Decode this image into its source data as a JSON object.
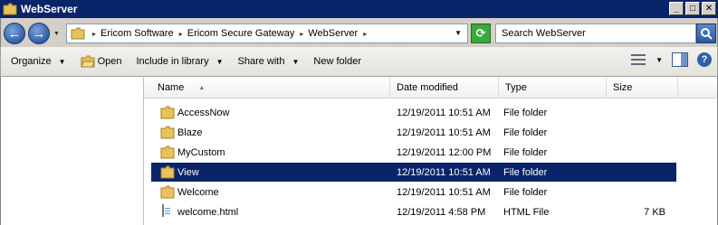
{
  "window": {
    "title": "WebServer"
  },
  "address": {
    "crumbs": [
      "Ericom Software",
      "Ericom Secure Gateway",
      "WebServer"
    ]
  },
  "search": {
    "placeholder": "Search WebServer"
  },
  "toolbar": {
    "organize_label": "Organize",
    "open_label": "Open",
    "include_label": "Include in library",
    "share_label": "Share with",
    "newfolder_label": "New folder"
  },
  "columns": {
    "name": "Name",
    "date": "Date modified",
    "type": "Type",
    "size": "Size"
  },
  "files": [
    {
      "name": "AccessNow",
      "date": "12/19/2011 10:51 AM",
      "type": "File folder",
      "size": "",
      "icon": "folder-icon",
      "selected": false
    },
    {
      "name": "Blaze",
      "date": "12/19/2011 10:51 AM",
      "type": "File folder",
      "size": "",
      "icon": "folder-icon",
      "selected": false
    },
    {
      "name": "MyCustom",
      "date": "12/19/2011 12:00 PM",
      "type": "File folder",
      "size": "",
      "icon": "folder-icon",
      "selected": false
    },
    {
      "name": "View",
      "date": "12/19/2011 10:51 AM",
      "type": "File folder",
      "size": "",
      "icon": "folder-icon",
      "selected": true
    },
    {
      "name": "Welcome",
      "date": "12/19/2011 10:51 AM",
      "type": "File folder",
      "size": "",
      "icon": "folder-icon",
      "selected": false
    },
    {
      "name": "welcome.html",
      "date": "12/19/2011 4:58 PM",
      "type": "HTML File",
      "size": "7 KB",
      "icon": "html-file-icon",
      "selected": false
    }
  ],
  "colors": {
    "titlebar": "#0a246a",
    "selection": "#0a246a",
    "folder": "#e8c25a"
  }
}
